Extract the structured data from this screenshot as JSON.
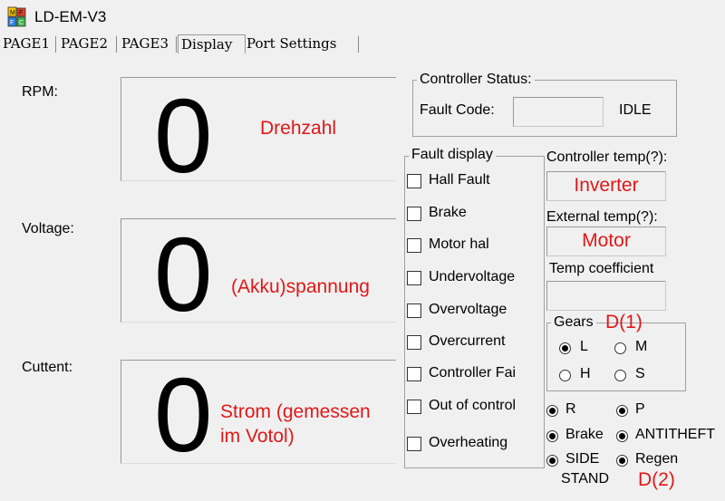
{
  "window": {
    "title": "LD-EM-V3"
  },
  "tabs": [
    {
      "label": "PAGE1"
    },
    {
      "label": "PAGE2"
    },
    {
      "label": "PAGE3"
    },
    {
      "label": "Display"
    },
    {
      "label": "Port Settings"
    }
  ],
  "readouts": {
    "rpm": {
      "label": "RPM:",
      "value": "0",
      "annotation": "Drehzahl"
    },
    "voltage": {
      "label": "Voltage:",
      "value": "0",
      "annotation": "(Akku)spannung"
    },
    "current": {
      "label": "Cuttent:",
      "value": "0",
      "annotation_line1": "Strom (gemessen",
      "annotation_line2": "im Votol)"
    }
  },
  "controller_status": {
    "title": "Controller Status:",
    "fault_code_label": "Fault Code:",
    "fault_code_value": "",
    "state": "IDLE"
  },
  "fault_display": {
    "title": "Fault display",
    "items": [
      {
        "label": "Hall Fault",
        "checked": false
      },
      {
        "label": "Brake",
        "checked": false
      },
      {
        "label": "Motor hal",
        "checked": false
      },
      {
        "label": "Undervoltage",
        "checked": false
      },
      {
        "label": "Overvoltage",
        "checked": false
      },
      {
        "label": "Overcurrent",
        "checked": false
      },
      {
        "label": "Controller Failure",
        "checked": false
      },
      {
        "label": "Out of control",
        "checked": false
      },
      {
        "label": "Overheating",
        "checked": false
      }
    ]
  },
  "temps": {
    "controller_label": "Controller temp(?):",
    "controller_value": "Inverter",
    "external_label": "External temp(?):",
    "external_value": "Motor",
    "coeff_label": "Temp coefficient",
    "coeff_value": ""
  },
  "gears": {
    "title": "Gears",
    "annotation": "D(1)",
    "options": [
      {
        "label": "L",
        "selected": true
      },
      {
        "label": "M",
        "selected": false
      },
      {
        "label": "H",
        "selected": false
      },
      {
        "label": "S",
        "selected": false
      }
    ]
  },
  "status_indicators": [
    {
      "label": "R",
      "on": true
    },
    {
      "label": "P",
      "on": true
    },
    {
      "label": "Brake",
      "on": true
    },
    {
      "label": "ANTITHEFT",
      "on": true
    },
    {
      "label": "SIDE",
      "label2": "STAND",
      "on": true
    },
    {
      "label": "Regen",
      "on": true
    }
  ],
  "annotation_d2": "D(2)",
  "colors": {
    "annotation": "#e01818",
    "background": "#f0f0f0"
  }
}
